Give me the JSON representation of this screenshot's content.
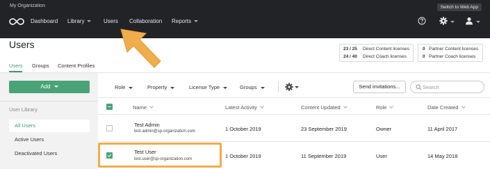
{
  "org": {
    "name": "My Organization"
  },
  "switch_button": "Switch to Web App",
  "nav": [
    {
      "label": "Dashboard",
      "has_caret": false
    },
    {
      "label": "Library",
      "has_caret": true
    },
    {
      "label": "Users",
      "has_caret": false
    },
    {
      "label": "Collaboration",
      "has_caret": false
    },
    {
      "label": "Reports",
      "has_caret": true
    }
  ],
  "top_icons": [
    "help-icon",
    "gear-icon",
    "user-icon"
  ],
  "page_title": "Users",
  "subtabs": [
    {
      "label": "Users",
      "active": true
    },
    {
      "label": "Groups",
      "active": false
    },
    {
      "label": "Content Profiles",
      "active": false
    }
  ],
  "licenses": {
    "direct": [
      {
        "count": "23 / 25",
        "label": "Direct Content licenses"
      },
      {
        "count": "24 / 40",
        "label": "Direct Coach licenses"
      }
    ],
    "partner": [
      {
        "count": "0",
        "label": "Partner Content licenses"
      },
      {
        "count": "0",
        "label": "Partner Coach licenses"
      }
    ]
  },
  "add_button": "Add",
  "filters": [
    "Role",
    "Property",
    "License Type",
    "Groups"
  ],
  "send_invitations": "Send invitations...",
  "search": {
    "placeholder": "Search",
    "value": ""
  },
  "sidebar": {
    "heading": "User Library",
    "items": [
      {
        "label": "All Users",
        "active": true
      },
      {
        "label": "Active Users",
        "active": false
      },
      {
        "label": "Deactivated Users",
        "active": false
      }
    ]
  },
  "table": {
    "columns": [
      "Name",
      "Latest Activity",
      "Content Updated",
      "Role",
      "Date Created"
    ],
    "rows": [
      {
        "checked": false,
        "name": "Test Admin",
        "email": "test.admin@sp-organization.com",
        "latest_activity": "1 October 2019",
        "content_updated": "23 September 2019",
        "role": "Owner",
        "date_created": "11 April 2017"
      },
      {
        "checked": true,
        "name": "Test User",
        "email": "test.user@sp-organization.com",
        "latest_activity": "1 October 2019",
        "content_updated": "11 September 2019",
        "role": "User",
        "date_created": "14 May 2018"
      }
    ]
  },
  "colors": {
    "topbar": "#222326",
    "accent": "#4aa377",
    "highlight": "#f0ad4e"
  }
}
